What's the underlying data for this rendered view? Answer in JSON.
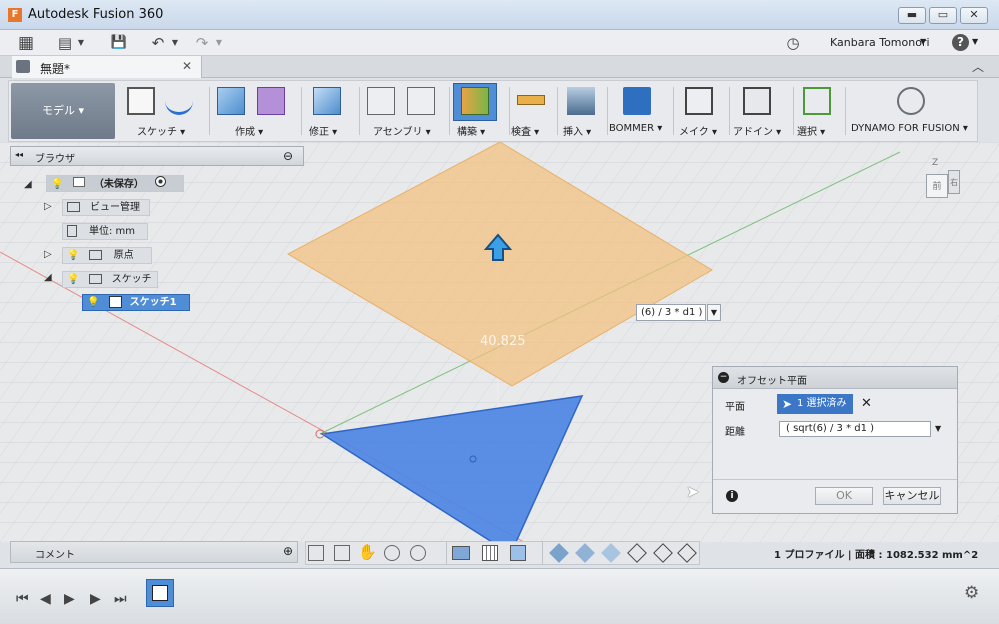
{
  "window": {
    "title": "Autodesk Fusion 360",
    "app_icon": "F",
    "min_label": "▬",
    "max_label": "▭",
    "close_label": "✕"
  },
  "qat": {
    "user": "Kanbara Tomonori",
    "user_caret": "▼",
    "help": "?",
    "help_caret": "▼",
    "grid_icon": "▦",
    "file_icon": "▤",
    "file_caret": "▼",
    "save_icon": "💾",
    "undo_icon": "↶",
    "undo_caret": "▼",
    "redo_icon": "↷",
    "redo_caret": "▼",
    "clock_icon": "◷"
  },
  "tab": {
    "label": "無題*",
    "close": "✕",
    "collapse": "︿"
  },
  "toolbar": {
    "workspace": "モデル ▾",
    "groups": [
      {
        "label": "スケッチ ▾"
      },
      {
        "label": "作成 ▾"
      },
      {
        "label": "修正 ▾"
      },
      {
        "label": "アセンブリ ▾"
      },
      {
        "label": "構築 ▾"
      },
      {
        "label": "検査 ▾"
      },
      {
        "label": "挿入 ▾"
      },
      {
        "label": "BOMMER ▾"
      },
      {
        "label": "メイク ▾"
      },
      {
        "label": "アドイン ▾"
      },
      {
        "label": "選択 ▾"
      },
      {
        "label": "DYNAMO FOR FUSION ▾"
      }
    ]
  },
  "browser": {
    "title": "ブラウザ",
    "back_icon": "◂◂",
    "minus_icon": "⊖",
    "root": "（未保存）",
    "items": [
      {
        "label": "ビュー管理"
      },
      {
        "label": "単位: mm"
      },
      {
        "label": "原点"
      },
      {
        "label": "スケッチ"
      },
      {
        "label": "スケッチ1"
      }
    ]
  },
  "viewport": {
    "dimension_label": "40.825",
    "float_input": "(6) / 3 * d1 )"
  },
  "dialog": {
    "title": "オフセット平面",
    "plane_label": "平面",
    "plane_value": "1 選択済み",
    "plane_clear": "✕",
    "distance_label": "距離",
    "distance_value": "( sqrt(6) / 3 * d1 )",
    "ok": "OK",
    "cancel": "キャンセル",
    "info": "i"
  },
  "comment": {
    "label": "コメント",
    "add": "⊕"
  },
  "status": {
    "text": "1 プロファイル | 面積 : 1082.532 mm^2"
  },
  "viewcube": {
    "front": "前",
    "right": "右",
    "z": "Z"
  },
  "timeline": {
    "first": "⏮",
    "prev": "◀",
    "play": "▶",
    "next": "▶",
    "last": "⏭",
    "gear": "⚙"
  },
  "colors": {
    "accent": "#3b77c6",
    "offset_plane": "#f2c07d",
    "sketch_face": "#4d86e3"
  }
}
